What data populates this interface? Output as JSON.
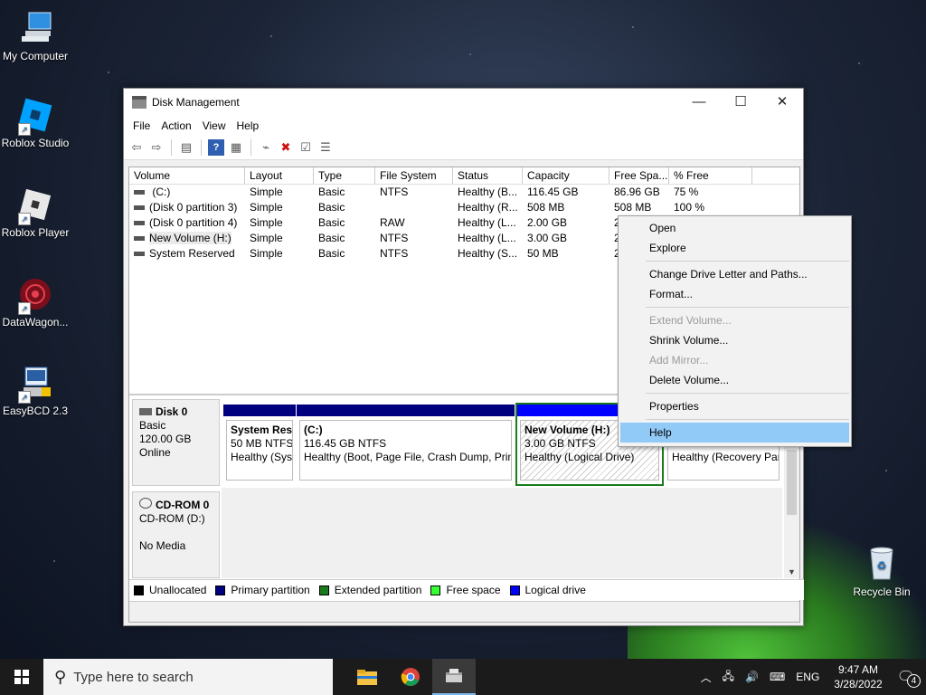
{
  "desktop_icons": [
    {
      "label": "My Computer",
      "icon": "computer-icon"
    },
    {
      "label": "Roblox Studio",
      "icon": "roblox-studio-icon"
    },
    {
      "label": "Roblox Player",
      "icon": "roblox-player-icon"
    },
    {
      "label": "DataWagon...",
      "icon": "datawagon-icon"
    },
    {
      "label": "EasyBCD 2.3",
      "icon": "easybcd-icon"
    },
    {
      "label": "Recycle Bin",
      "icon": "recycle-bin-icon"
    }
  ],
  "window": {
    "title": "Disk Management",
    "menu": [
      "File",
      "Action",
      "View",
      "Help"
    ]
  },
  "volume_table": {
    "columns": [
      "Volume",
      "Layout",
      "Type",
      "File System",
      "Status",
      "Capacity",
      "Free Spa...",
      "% Free"
    ],
    "rows": [
      {
        "volume": " (C:)",
        "layout": "Simple",
        "type": "Basic",
        "fs": "NTFS",
        "status": "Healthy (B...",
        "capacity": "116.45 GB",
        "free": "86.96 GB",
        "pct": "75 %"
      },
      {
        "volume": "(Disk 0 partition 3)",
        "layout": "Simple",
        "type": "Basic",
        "fs": "",
        "status": "Healthy (R...",
        "capacity": "508 MB",
        "free": "508 MB",
        "pct": "100 %"
      },
      {
        "volume": "(Disk 0 partition 4)",
        "layout": "Simple",
        "type": "Basic",
        "fs": "RAW",
        "status": "Healthy (L...",
        "capacity": "2.00 GB",
        "free": "2",
        "pct": ""
      },
      {
        "volume": "New Volume (H:)",
        "layout": "Simple",
        "type": "Basic",
        "fs": "NTFS",
        "status": "Healthy (L...",
        "capacity": "3.00 GB",
        "free": "2",
        "pct": ""
      },
      {
        "volume": "System Reserved",
        "layout": "Simple",
        "type": "Basic",
        "fs": "NTFS",
        "status": "Healthy (S...",
        "capacity": "50 MB",
        "free": "2",
        "pct": ""
      }
    ]
  },
  "disk0": {
    "name": "Disk 0",
    "type": "Basic",
    "size": "120.00 GB",
    "state": "Online",
    "partitions": [
      {
        "title": "System Res",
        "line2": "50 MB NTFS",
        "line3": "Healthy (Sys"
      },
      {
        "title": "(C:)",
        "line2": "116.45 GB NTFS",
        "line3": "Healthy (Boot, Page File, Crash Dump, Prin"
      },
      {
        "title": "New Volume  (H:)",
        "line2": "3.00 GB NTFS",
        "line3": "Healthy (Logical Drive)"
      },
      {
        "title": "",
        "line2": "508 MB",
        "line3": "Healthy (Recovery Par"
      }
    ]
  },
  "cdrom0": {
    "name": "CD-ROM 0",
    "drive": "CD-ROM (D:)",
    "media": "No Media"
  },
  "legend": [
    {
      "label": "Unallocated",
      "color": "#000000"
    },
    {
      "label": "Primary partition",
      "color": "#00007f"
    },
    {
      "label": "Extended partition",
      "color": "#1b7a1b"
    },
    {
      "label": "Free space",
      "color": "#33ff33"
    },
    {
      "label": "Logical drive",
      "color": "#0000ff"
    }
  ],
  "context_menu": {
    "items": [
      {
        "label": "Open",
        "enabled": true
      },
      {
        "label": "Explore",
        "enabled": true
      },
      {
        "label": "Change Drive Letter and Paths...",
        "enabled": true
      },
      {
        "label": "Format...",
        "enabled": true
      },
      {
        "label": "Extend Volume...",
        "enabled": false
      },
      {
        "label": "Shrink Volume...",
        "enabled": true
      },
      {
        "label": "Add Mirror...",
        "enabled": false
      },
      {
        "label": "Delete Volume...",
        "enabled": true
      },
      {
        "label": "Properties",
        "enabled": true
      },
      {
        "label": "Help",
        "enabled": true,
        "highlighted": true
      }
    ]
  },
  "taskbar": {
    "search_placeholder": "Type here to search",
    "language": "ENG",
    "time": "9:47 AM",
    "date": "3/28/2022",
    "notifications": "4"
  }
}
